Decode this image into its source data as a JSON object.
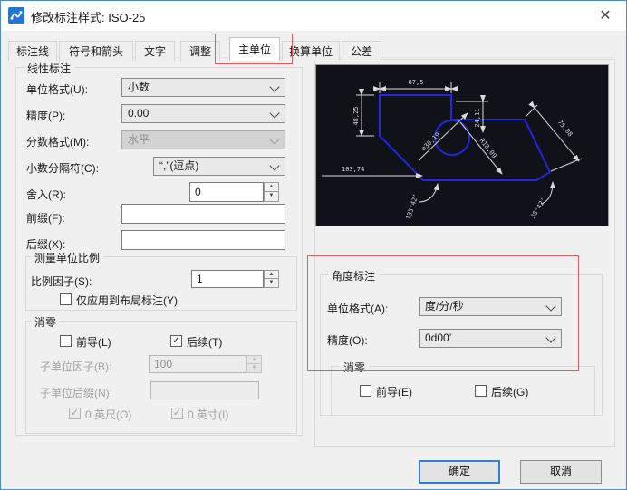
{
  "window": {
    "title": "修改标注样式: ISO-25"
  },
  "icons": {
    "close": "✕",
    "check": "✓",
    "spin_up": "▲",
    "spin_down": "▼"
  },
  "tabs": [
    "标注线",
    "符号和箭头",
    "文字",
    "调整",
    "主单位",
    "换算单位",
    "公差"
  ],
  "active_tab": "主单位",
  "linear": {
    "title": "线性标注",
    "unit_format": {
      "label": "单位格式(U):",
      "value": "小数"
    },
    "precision": {
      "label": "精度(P):",
      "value": "0.00"
    },
    "fraction_format": {
      "label": "分数格式(M):",
      "value": "水平",
      "disabled": true
    },
    "decimal_separator": {
      "label": "小数分隔符(C):",
      "value": "“,”(逗点)"
    },
    "round_off": {
      "label": "舍入(R):",
      "value": "0"
    },
    "prefix": {
      "label": "前缀(F):",
      "value": ""
    },
    "suffix": {
      "label": "后缀(X):",
      "value": ""
    },
    "measurement_scale": {
      "title": "测量单位比例",
      "scale_factor": {
        "label": "比例因子(S):",
        "value": "1"
      },
      "layout_only": {
        "label": "仅应用到布局标注(Y)",
        "checked": false
      }
    },
    "zero_suppression": {
      "title": "消零",
      "leading": {
        "label": "前导(L)",
        "checked": false
      },
      "trailing": {
        "label": "后续(T)",
        "checked": true
      },
      "sub_unit_factor": {
        "label": "子单位因子(B):",
        "value": "100",
        "disabled": true
      },
      "sub_unit_suffix": {
        "label": "子单位后缀(N):",
        "value": "",
        "disabled": true
      },
      "feet": {
        "label": "0 英尺(O)",
        "checked": true,
        "disabled": true
      },
      "inches": {
        "label": "0 英寸(I)",
        "checked": true,
        "disabled": true
      }
    }
  },
  "angular": {
    "title": "角度标注",
    "unit_format": {
      "label": "单位格式(A):",
      "value": "度/分/秒"
    },
    "precision": {
      "label": "精度(O):",
      "value": "0d00’"
    },
    "zero_suppression": {
      "title": "消零",
      "leading": {
        "label": "前导(E)",
        "checked": false
      },
      "trailing": {
        "label": "后续(G)",
        "checked": false
      }
    }
  },
  "preview": {
    "dims": [
      "87,5",
      "48,25",
      "24,11",
      "⌀30,19",
      "R18,09",
      "75,08",
      "103,74",
      "135°42’",
      "38°42’"
    ]
  },
  "buttons": {
    "ok": "确定",
    "cancel": "取消"
  },
  "colors": {
    "accent": "#2f7fd6",
    "annotation": "#d86060",
    "preview_shape": "#2824d8"
  }
}
